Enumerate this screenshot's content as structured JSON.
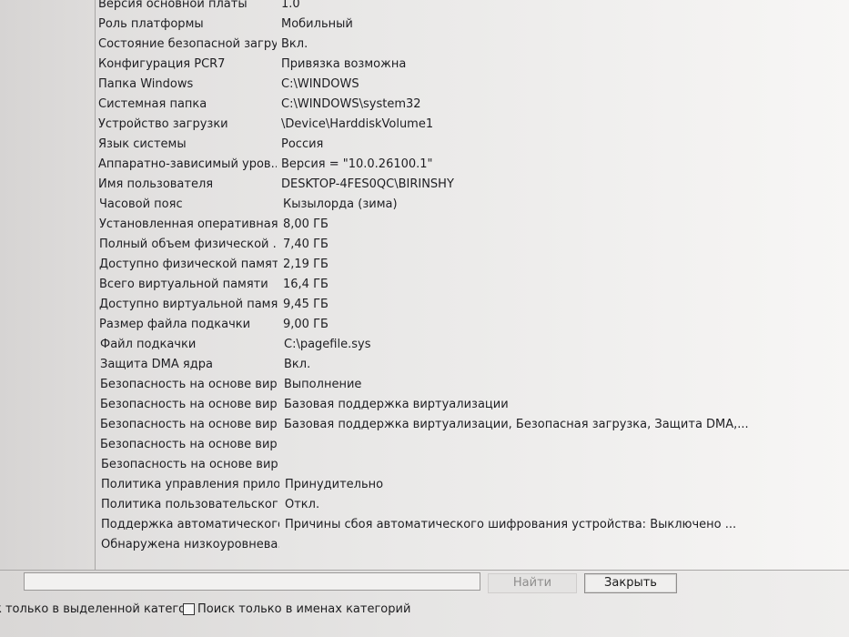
{
  "table": {
    "rows": [
      {
        "key": "Версия основной платы",
        "value": "1.0"
      },
      {
        "key": "Роль платформы",
        "value": "Мобильный"
      },
      {
        "key": "Состояние безопасной загру...",
        "value": "Вкл."
      },
      {
        "key": "Конфигурация PCR7",
        "value": "Привязка возможна"
      },
      {
        "key": "Папка Windows",
        "value": "C:\\WINDOWS"
      },
      {
        "key": "Системная папка",
        "value": "C:\\WINDOWS\\system32"
      },
      {
        "key": "Устройство загрузки",
        "value": "\\Device\\HarddiskVolume1"
      },
      {
        "key": "Язык системы",
        "value": "Россия"
      },
      {
        "key": "Аппаратно-зависимый уров...",
        "value": "Версия = \"10.0.26100.1\""
      },
      {
        "key": "Имя пользователя",
        "value": "DESKTOP-4FES0QC\\BIRINSHY"
      },
      {
        "key": "Часовой пояс",
        "value": "Кызылорда (зима)"
      },
      {
        "key": "Установленная оперативная...",
        "value": "8,00 ГБ"
      },
      {
        "key": "Полный объем физической ...",
        "value": "7,40 ГБ"
      },
      {
        "key": "Доступно физической памяти",
        "value": "2,19 ГБ"
      },
      {
        "key": "Всего виртуальной памяти",
        "value": "16,4 ГБ"
      },
      {
        "key": "Доступно виртуальной памя...",
        "value": "9,45 ГБ"
      },
      {
        "key": "Размер файла подкачки",
        "value": "9,00 ГБ"
      },
      {
        "key": "Файл подкачки",
        "value": "C:\\pagefile.sys"
      },
      {
        "key": "Защита DMA ядра",
        "value": "Вкл."
      },
      {
        "key": "Безопасность на основе вир...",
        "value": "Выполнение"
      },
      {
        "key": "Безопасность на основе вир...",
        "value": "Базовая поддержка виртуализации"
      },
      {
        "key": "Безопасность на основе вир...",
        "value": "Базовая поддержка виртуализации, Безопасная загрузка, Защита DMA,..."
      },
      {
        "key": "Безопасность на основе вир...",
        "value": ""
      },
      {
        "key": "Безопасность на основе вир...",
        "value": ""
      },
      {
        "key": "Политика управления прило...",
        "value": "Принудительно"
      },
      {
        "key": "Политика пользовательског...",
        "value": "Откл."
      },
      {
        "key": "Поддержка автоматического...",
        "value": "Причины сбоя автоматического шифрования устройства: Выключено ..."
      },
      {
        "key": "Обнаружена низкоуровнева...",
        "value": ""
      }
    ]
  },
  "search": {
    "value": "",
    "find_label": "Найти",
    "close_label": "Закрыть"
  },
  "options": {
    "selected_category_label": "к только в выделенной категор",
    "names_only_label": "Поиск только в именах категорий",
    "names_only_checked": false
  }
}
